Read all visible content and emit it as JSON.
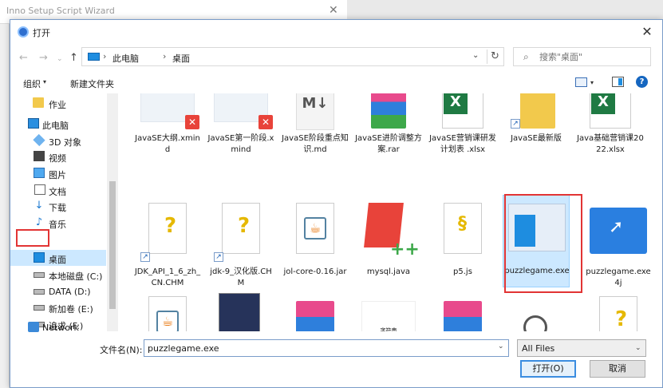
{
  "background_window": {
    "title": "Inno Setup Script Wizard",
    "close": "✕"
  },
  "dialog": {
    "title": "打开",
    "close": "✕"
  },
  "nav": {
    "back": "←",
    "forward": "→",
    "recent": "⌄",
    "up": "↑"
  },
  "address": {
    "crumbs": [
      "此电脑",
      "桌面"
    ],
    "sep": "›",
    "dropdown": "⌄",
    "refresh": "↻"
  },
  "search": {
    "placeholder": "搜索\"桌面\"",
    "icon": "⌕"
  },
  "toolbar": {
    "organize": "组织",
    "new_folder": "新建文件夹",
    "dropdown": "▾",
    "help": "?"
  },
  "sidebar": {
    "items": [
      {
        "label": "作业",
        "icon": "folder-icon"
      },
      {
        "label": "此电脑",
        "icon": "pc-icon"
      },
      {
        "label": "3D 对象",
        "icon": "3d-objects-icon"
      },
      {
        "label": "视频",
        "icon": "video-icon"
      },
      {
        "label": "图片",
        "icon": "pictures-icon"
      },
      {
        "label": "文档",
        "icon": "documents-icon"
      },
      {
        "label": "下载",
        "icon": "downloads-icon"
      },
      {
        "label": "音乐",
        "icon": "music-icon"
      },
      {
        "label": "桌面",
        "icon": "desktop-icon",
        "selected": true
      },
      {
        "label": "本地磁盘 (C:)",
        "icon": "drive-icon"
      },
      {
        "label": "DATA (D:)",
        "icon": "drive-icon"
      },
      {
        "label": "新加卷 (E:)",
        "icon": "drive-icon"
      },
      {
        "label": "追求 (F:)",
        "icon": "drive-icon"
      },
      {
        "label": "Network",
        "icon": "network-icon"
      }
    ]
  },
  "files": [
    {
      "name": "JavaSE大纲.xmind",
      "type": "xmind"
    },
    {
      "name": "JavaSE第一阶段.xmind",
      "type": "xmind"
    },
    {
      "name": "JavaSE阶段重点知识.md",
      "type": "md"
    },
    {
      "name": "JavaSE进阶调整方案.rar",
      "type": "rar"
    },
    {
      "name": "JavaSE营销课研发计划表 .xlsx",
      "type": "xlsx"
    },
    {
      "name": "JavaSE最新版",
      "type": "folder-shortcut"
    },
    {
      "name": "Java基础营销课2022.xlsx",
      "type": "xlsx"
    },
    {
      "name": "JDK_API_1_6_zh_CN.CHM",
      "type": "chm-shortcut"
    },
    {
      "name": "jdk-9_汉化版.CHM",
      "type": "chm-shortcut"
    },
    {
      "name": "jol-core-0.16.jar",
      "type": "jar"
    },
    {
      "name": "mysql.java",
      "type": "sublime"
    },
    {
      "name": "p5.js",
      "type": "js"
    },
    {
      "name": "puzzlegame.exe",
      "type": "exe",
      "selected": true
    },
    {
      "name": "puzzlegame.exe4j",
      "type": "e4j"
    },
    {
      "name": "",
      "type": "jar"
    },
    {
      "name": "",
      "type": "book"
    },
    {
      "name": "",
      "type": "rar"
    },
    {
      "name": "字符串",
      "type": "image"
    },
    {
      "name": "",
      "type": "rar"
    },
    {
      "name": "",
      "type": "setup"
    },
    {
      "name": "",
      "type": "chm"
    }
  ],
  "bottom": {
    "filename_label": "文件名(N):",
    "filename_value": "puzzlegame.exe",
    "filter_value": "All Files",
    "open_button": "打开(O)",
    "cancel_button": "取消",
    "dropdown": "⌄"
  },
  "colors": {
    "selection": "#cce8ff",
    "highlight_outline": "#e23434",
    "accent": "#1e8de0"
  }
}
